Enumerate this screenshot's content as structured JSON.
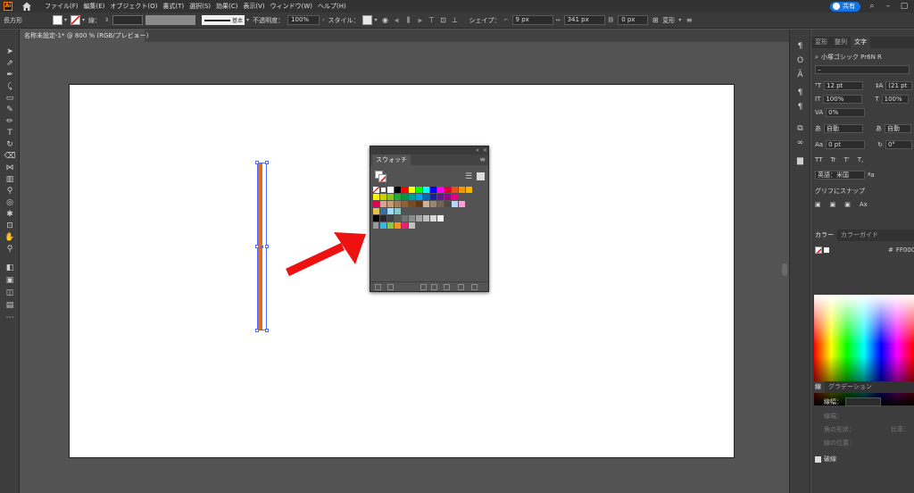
{
  "menubar": {
    "logo": "Ai",
    "menus": [
      "ファイル(F)",
      "編集(E)",
      "オブジェクト(O)",
      "書式(T)",
      "選択(S)",
      "効果(C)",
      "表示(V)",
      "ウィンドウ(W)",
      "ヘルプ(H)"
    ],
    "share_label": "共有"
  },
  "controlbar": {
    "object_type": "長方形",
    "stroke_label": "線：",
    "stroke_style": "基本",
    "opacity_label": "不透明度：",
    "opacity_value": "100%",
    "style_label": "スタイル：",
    "shape_label": "シェイプ：",
    "corner_value": "9 px",
    "width_value": "341 px",
    "offset_value": "0 px",
    "transform_label": "変形"
  },
  "document": {
    "tab_title": "名称未設定-1* @ 800 % (RGB/プレビュー)",
    "close": "×"
  },
  "swatches": {
    "title": "スウォッチ",
    "menu": "≡",
    "collapse": "«",
    "close": "×"
  },
  "right_panel": {
    "tabs": [
      "変形",
      "整列",
      "文字"
    ],
    "active_tab": "文字",
    "font_name": "小塚ゴシック Pr6N R",
    "font_style": "–",
    "font_size": "12 pt",
    "leading": "(21 pt",
    "vscale": "100%",
    "hscale": "100%",
    "tracking": "0%",
    "kerning": "自動",
    "kerning2": "自動",
    "baseline": "0 pt",
    "rotation": "0°",
    "tt_buttons": [
      "TT",
      "Tr",
      "T'",
      "T,"
    ],
    "language": "英語：米国",
    "aa_label": "ªa",
    "snap_label": "グリフにスナップ",
    "color_tabs": [
      "カラー",
      "カラーガイド"
    ],
    "hex_value": "FF000",
    "stroke_tabs": [
      "線",
      "グラデーション"
    ],
    "stroke_weight_label": "線幅：",
    "options": [
      "線端：",
      "角の形状：",
      "比率：",
      "線の位置：",
      "破線"
    ],
    "dash_label": "破線"
  },
  "colors": {
    "orange": "#e36c1e",
    "arrow": "#ee1111",
    "accent": "#1473e6",
    "selection": "#4f6cff"
  }
}
